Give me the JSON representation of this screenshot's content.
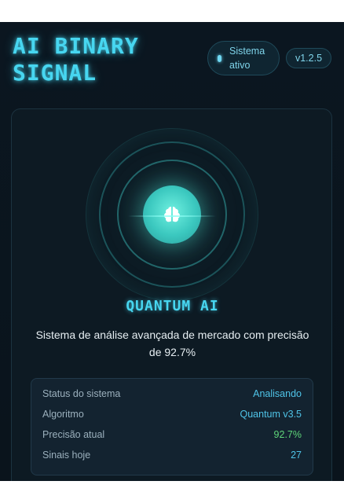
{
  "header": {
    "title": "AI BINARY SIGNAL",
    "status_text": "Sistema ativo",
    "version": "v1.2.5"
  },
  "card": {
    "icon": "brain-icon",
    "title": "QUANTUM AI",
    "description": "Sistema de análise avançada de mercado com precisão de 92.7%"
  },
  "stats": [
    {
      "label": "Status do sistema",
      "value": "Analisando"
    },
    {
      "label": "Algoritmo",
      "value": "Quantum v3.5"
    },
    {
      "label": "Precisão atual",
      "value": "92.7%"
    },
    {
      "label": "Sinais hoje",
      "value": "27"
    }
  ],
  "colors": {
    "accent": "#47d6f0",
    "orb": "#3bc8bf",
    "positive": "#5fd67a"
  }
}
